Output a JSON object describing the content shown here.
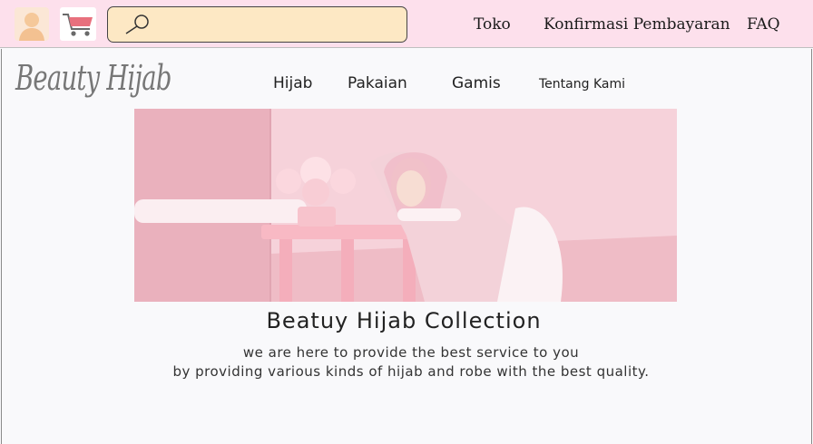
{
  "header": {
    "search": {
      "placeholder": "",
      "value": ""
    },
    "links": [
      "Toko",
      "Konfirmasi Pembayaran",
      "FAQ"
    ],
    "icons": {
      "profile": "user-avatar-icon",
      "cart": "shopping-cart-icon",
      "search": "magnifier-icon"
    }
  },
  "brand": {
    "name": "Beauty Hijab"
  },
  "nav": {
    "items": [
      "Hijab",
      "Pakaian",
      "Gamis",
      "Tentang Kami"
    ]
  },
  "hero": {
    "title": "Beatuy Hijab Collection",
    "tagline_line1": "we are here to provide the best service to you",
    "tagline_line2": "by providing various kinds of hijab and robe with the best quality."
  },
  "colors": {
    "header_bg": "#fde0ec",
    "search_bg": "#fde8c4",
    "page_bg": "#f9f9fb",
    "cart_accent": "#e8707d"
  }
}
